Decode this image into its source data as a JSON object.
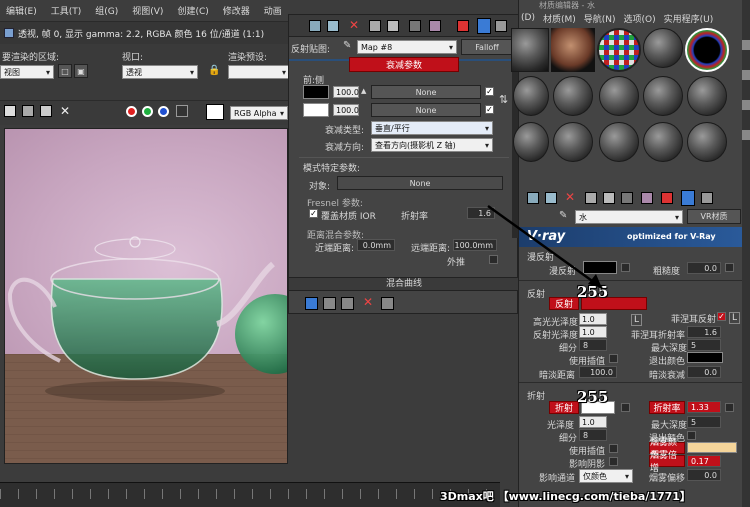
{
  "menubar": {
    "items": [
      "编辑(E)",
      "工具(T)",
      "组(G)",
      "视图(V)",
      "创建(C)",
      "修改器",
      "动画"
    ]
  },
  "viewport_info": {
    "text": "透视, 帧 0, 显示 gamma: 2.2, RGBA 颜色 16 位/通道 (1:1)"
  },
  "render_area": {
    "label": "要渲染的区域:",
    "value": "视图"
  },
  "viewport_select": {
    "label": "视口:",
    "value": "透视"
  },
  "render_preset": {
    "label": "渲染预设:"
  },
  "channel": {
    "value": "RGB Alpha"
  },
  "falloff_panel": {
    "map_label": "反射贴图:",
    "map_value": "Map #8",
    "map_type": "Falloff",
    "rollout_title": "衰减参数",
    "front_side": "前:侧",
    "amount1": "100.0",
    "amount2": "100.0",
    "none1": "None",
    "none2": "None",
    "falloff_type_label": "衰减类型:",
    "falloff_type_value": "垂直/平行",
    "falloff_dir_label": "衰减方向:",
    "falloff_dir_value": "查看方向(摄影机 Z 轴)",
    "mode_title": "模式特定参数:",
    "object_label": "对象:",
    "object_value": "None",
    "fresnel_title": "Fresnel 参数:",
    "override_ior": "覆盖材质 IOR",
    "ior_label": "折射率",
    "ior_value": "1.6",
    "distance_title": "距离混合参数:",
    "near_label": "近端距离:",
    "near_value": "0.0mm",
    "far_label": "远端距离:",
    "far_value": "100.0mm",
    "extrapolate": "外推",
    "mix_curve": "混合曲线"
  },
  "material_editor": {
    "title": "材质编辑器 - 水",
    "menu": [
      "(D)",
      "材质(M)",
      "导航(N)",
      "选项(O)",
      "实用程序(U)"
    ],
    "material_name": "水",
    "material_type": "VR材质",
    "vray_tagline": "optimized for V-Ray",
    "diffuse_title": "漫反射",
    "diffuse_label": "漫反射",
    "roughness_label": "粗糙度",
    "roughness_value": "0.0",
    "reflection_title": "反射",
    "reflect_label": "反射",
    "hilight_label": "高光光泽度",
    "hilight_value": "1.0",
    "refl_gloss_label": "反射光泽度",
    "refl_gloss_value": "1.0",
    "subdivs_label": "细分",
    "subdivs_value": "8",
    "fresnel_label": "菲涅耳反射",
    "fresnel_ior_label": "菲涅耳折射率",
    "fresnel_ior_value": "1.6",
    "max_depth_label": "最大深度",
    "max_depth_value": "5",
    "use_interp_label": "使用插值",
    "exit_color_label": "退出颜色",
    "dim_dist_label": "暗淡距离",
    "dim_dist_value": "100.0",
    "dim_falloff_label": "暗淡衰减",
    "dim_falloff_value": "0.0",
    "refraction_title": "折射",
    "refract_label": "折射",
    "ior_label": "折射率",
    "ior_value": "1.33",
    "gloss_label": "光泽度",
    "gloss_value": "1.0",
    "max_depth2_label": "最大深度",
    "max_depth2_value": "5",
    "subdivs2_label": "细分",
    "subdivs2_value": "8",
    "exit_color2_label": "退出颜色",
    "use_interp2_label": "使用插值",
    "fog_color_label": "烟雾颜色",
    "fog_mult_label": "烟雾倍增",
    "fog_mult_value": "0.17",
    "affect_shadows_label": "影响阴影",
    "affect_channels_label": "影响通道",
    "affect_channels_value": "仅颜色",
    "fog_bias_label": "烟雾偏移",
    "fog_bias_value": "0.0",
    "value_255_a": "255",
    "value_255_b": "255"
  },
  "watermark": {
    "text": "3Dmax吧 【www.linecg.com/tieba/1771】"
  },
  "colors": {
    "accent_red": "#c0101a",
    "fog_color": "#f5d59a",
    "diffuse_black": "#000000",
    "reflect_white": "#ffffff",
    "blue_button": "#3a7bd5"
  }
}
